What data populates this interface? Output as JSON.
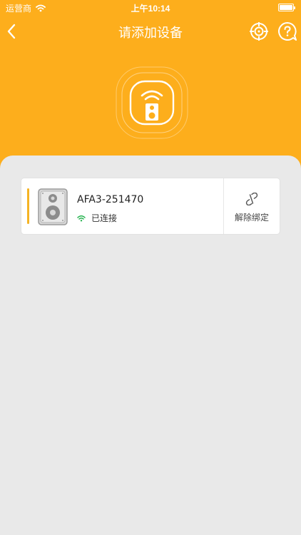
{
  "status_bar": {
    "carrier": "运营商",
    "time": "上午10:14"
  },
  "nav": {
    "title": "请添加设备",
    "back_icon": "chevron-left-icon",
    "target_icon": "target-icon",
    "help_icon": "help-bubble-icon"
  },
  "hero": {
    "icon": "wifi-speaker-icon"
  },
  "devices": [
    {
      "name": "AFA3-251470",
      "status": "已连接",
      "status_icon": "wifi-icon",
      "thumbnail": "speaker-icon",
      "action_label": "解除绑定",
      "action_icon": "unlink-icon"
    }
  ],
  "colors": {
    "brand": "#fdae1c",
    "connected": "#22b14c",
    "background": "#e9e9e9",
    "accent_bar": "#f5b324"
  }
}
